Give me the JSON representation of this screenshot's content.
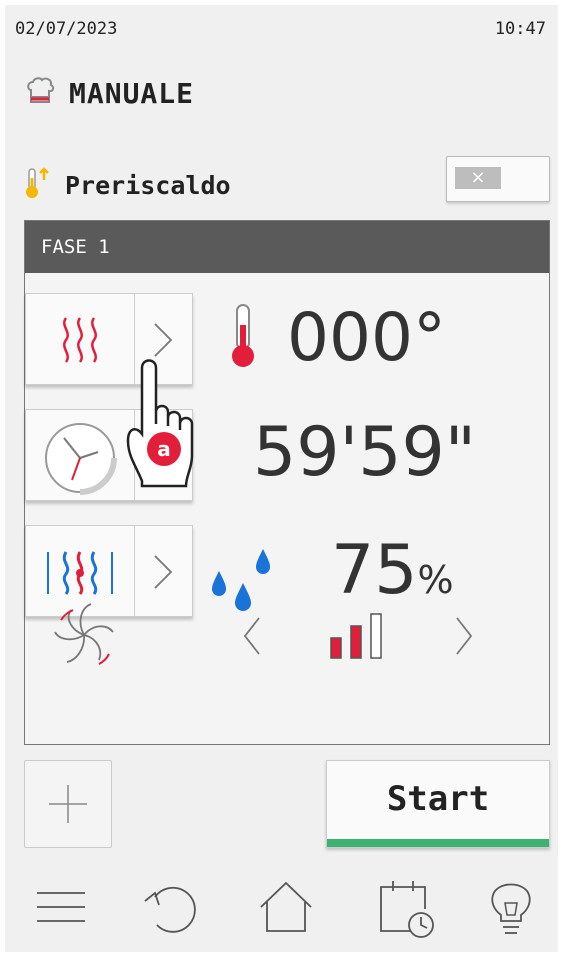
{
  "status": {
    "date": "02/07/2023",
    "time": "10:47"
  },
  "mode": {
    "title": "MANUALE",
    "icon": "chef-hat-icon"
  },
  "preheat": {
    "label": "Preriscaldo",
    "icon": "thermometer-up-icon",
    "toggle_symbol": "×"
  },
  "phase": {
    "header": "FASE 1",
    "temperature": {
      "value": "000°",
      "icon": "heat-waves-icon"
    },
    "time": {
      "value": "59'59\"",
      "icon": "clock-icon"
    },
    "humidity": {
      "value": "75",
      "unit": "%",
      "icon": "humidity-icon"
    },
    "fan": {
      "icon": "fan-icon",
      "level": 2,
      "max_level": 3
    }
  },
  "hint": {
    "badge": "a"
  },
  "actions": {
    "add_symbol": "+",
    "start_label": "Start"
  },
  "nav": [
    "menu-icon",
    "undo-icon",
    "home-icon",
    "schedule-icon",
    "tips-icon"
  ],
  "colors": {
    "accent_red": "#e31e3a",
    "accent_blue": "#1a73d9",
    "start_green": "#3cb371"
  }
}
